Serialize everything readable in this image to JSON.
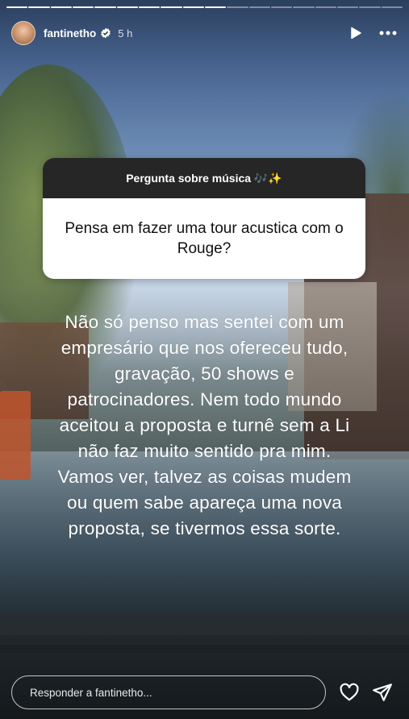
{
  "story": {
    "progress": {
      "total_segments": 18,
      "completed_segments": 10
    },
    "header": {
      "username": "fantinetho",
      "time": "5 h",
      "verified_icon": "verified-badge-icon",
      "play_icon": "play-icon",
      "more_icon": "more-horizontal-icon"
    },
    "question": {
      "title": "Pergunta sobre música 🎶✨",
      "text": "Pensa em fazer uma tour acustica com o Rouge?"
    },
    "answer": "Não só penso mas sentei com um empresário que nos ofereceu tudo, gravação, 50 shows e patrocinadores. Nem todo mundo aceitou a proposta e turnê sem a Li não faz muito sentido pra mim. Vamos ver, talvez as coisas mudem ou quem sabe apareça uma nova proposta, se tivermos essa sorte.",
    "reply": {
      "placeholder": "Responder a fantinetho...",
      "value": ""
    },
    "icons": {
      "like": "heart-icon",
      "share": "send-icon"
    }
  }
}
